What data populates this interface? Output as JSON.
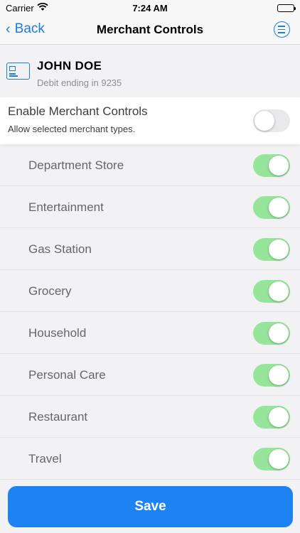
{
  "status_bar": {
    "carrier": "Carrier",
    "time": "7:24 AM"
  },
  "nav": {
    "back_label": "Back",
    "title": "Merchant Controls"
  },
  "card": {
    "name": "JOHN DOE",
    "subtitle": "Debit ending in 9235"
  },
  "master_control": {
    "title": "Enable Merchant Controls",
    "subtitle": "Allow selected merchant types.",
    "enabled": false
  },
  "merchant_types": [
    {
      "label": "Department Store",
      "enabled": true
    },
    {
      "label": "Entertainment",
      "enabled": true
    },
    {
      "label": "Gas Station",
      "enabled": true
    },
    {
      "label": "Grocery",
      "enabled": true
    },
    {
      "label": "Household",
      "enabled": true
    },
    {
      "label": "Personal Care",
      "enabled": true
    },
    {
      "label": "Restaurant",
      "enabled": true
    },
    {
      "label": "Travel",
      "enabled": true
    }
  ],
  "save_label": "Save",
  "colors": {
    "accent": "#1f7bdc",
    "save_button": "#1e83f2",
    "toggle_on": "#97e59b",
    "toggle_off": "#e9e9eb"
  }
}
